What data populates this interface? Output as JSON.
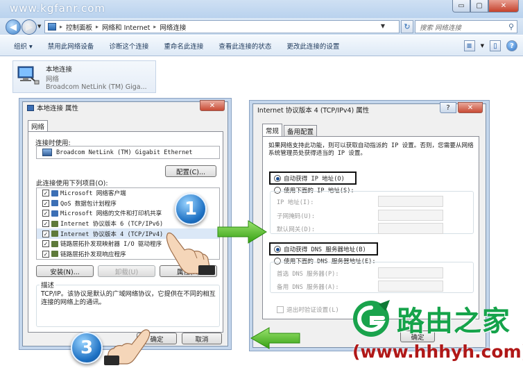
{
  "window": {
    "watermark": "www.kgfanr.com",
    "min_glyph": "▭",
    "max_glyph": "▢",
    "close_glyph": "✕"
  },
  "address": {
    "back_glyph": "◀",
    "forward_glyph": "▶",
    "crumbs": [
      "控制面板",
      "网络和 Internet",
      "网络连接"
    ],
    "separator": "▸",
    "refresh_glyph": "↻",
    "search_placeholder": "搜索 网络连接",
    "search_glyph": "⚲"
  },
  "commands": [
    "组织 ▾",
    "禁用此网络设备",
    "诊断这个连接",
    "重命名此连接",
    "查看此连接的状态",
    "更改此连接的设置"
  ],
  "network_item": {
    "name": "本地连接",
    "status": "网络",
    "device": "Broadcom NetLink (TM) Giga..."
  },
  "props": {
    "title": "本地连接 属性",
    "close_glyph": "✕",
    "tab": "网络",
    "connect_using": "连接时使用:",
    "adapter": "Broadcom NetLink (TM) Gigabit Ethernet",
    "configure": "配置(C)...",
    "items_label": "此连接使用下列项目(O):",
    "items": [
      {
        "label": "Microsoft 网络客户端",
        "checked": true,
        "color": "#3c6fb5"
      },
      {
        "label": "QoS 数据包计划程序",
        "checked": true,
        "color": "#3c6fb5"
      },
      {
        "label": "Microsoft 网络的文件和打印机共享",
        "checked": true,
        "color": "#3c6fb5"
      },
      {
        "label": "Internet 协议版本 6 (TCP/IPv6)",
        "checked": true,
        "color": "#5e7a3a"
      },
      {
        "label": "Internet 协议版本 4 (TCP/IPv4)",
        "checked": true,
        "color": "#5e7a3a"
      },
      {
        "label": "链路层拓扑发现映射器 I/O 驱动程序",
        "checked": true,
        "color": "#5e7a3a"
      },
      {
        "label": "链路层拓扑发现响应程序",
        "checked": true,
        "color": "#5e7a3a"
      }
    ],
    "install": "安装(N)...",
    "uninstall": "卸载(U)",
    "properties": "属性(R)",
    "desc_title": "描述",
    "desc_text": "TCP/IP。该协议是默认的广域网络协议，它提供在不同的相互连接的网络上的通讯。",
    "ok": "确定",
    "cancel": "取消"
  },
  "ipv4": {
    "title": "Internet 协议版本 4 (TCP/IPv4) 属性",
    "help_glyph": "?",
    "close_glyph": "✕",
    "tab_general": "常规",
    "tab_alt": "备用配置",
    "intro": "如果网络支持此功能，则可以获取自动指派的 IP 设置。否则，您需要从网络系统管理员处获得适当的 IP 设置。",
    "auto_ip": "自动获得 IP 地址(O)",
    "manual_ip": "使用下面的 IP 地址(S):",
    "ip_fields": [
      "IP 地址(I):",
      "子网掩码(U):",
      "默认网关(D):"
    ],
    "auto_dns": "自动获得 DNS 服务器地址(B)",
    "manual_dns": "使用下面的 DNS 服务器地址(E):",
    "dns_fields": [
      "首选 DNS 服务器(P):",
      "备用 DNS 服务器(A):"
    ],
    "validate": "退出时验证设置(L)",
    "ok_partial": "确定"
  },
  "steps": {
    "one": "1",
    "three": "3"
  },
  "brand": {
    "name": "路由之家",
    "url": "(www.hhhyh.com)"
  },
  "colors": {
    "badge": "#1f72c4",
    "arrow": "#4cb81e",
    "brand_green": "#15a34a",
    "brand_red": "#b01818"
  }
}
